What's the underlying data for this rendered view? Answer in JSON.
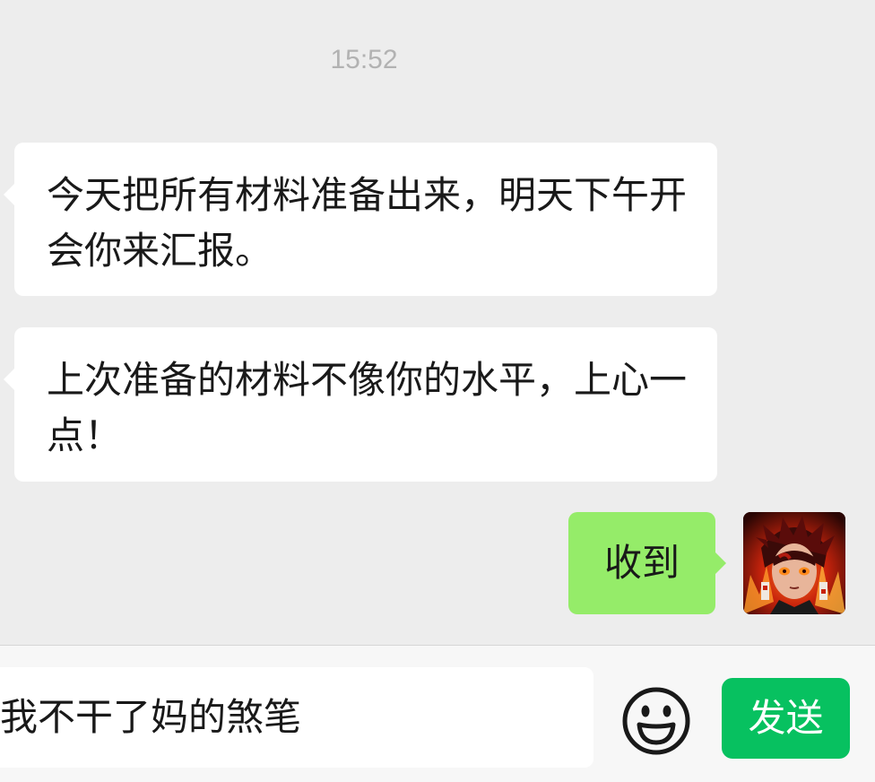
{
  "chat": {
    "timestamp": "15:52",
    "messages": [
      {
        "direction": "incoming",
        "text": "今天把所有材料准备出来，明天下午开会你来汇报。"
      },
      {
        "direction": "incoming",
        "text": "上次准备的材料不像你的水平，上心一点！"
      },
      {
        "direction": "outgoing",
        "text": "收到"
      }
    ]
  },
  "input_bar": {
    "input_value": "我不干了妈的煞笔",
    "emoji_icon": "smiley-face-icon",
    "send_label": "发送"
  },
  "colors": {
    "chat_background": "#ededed",
    "incoming_bubble": "#ffffff",
    "outgoing_bubble": "#95ec69",
    "send_button": "#07c160",
    "timestamp_text": "#b2b2b2"
  }
}
